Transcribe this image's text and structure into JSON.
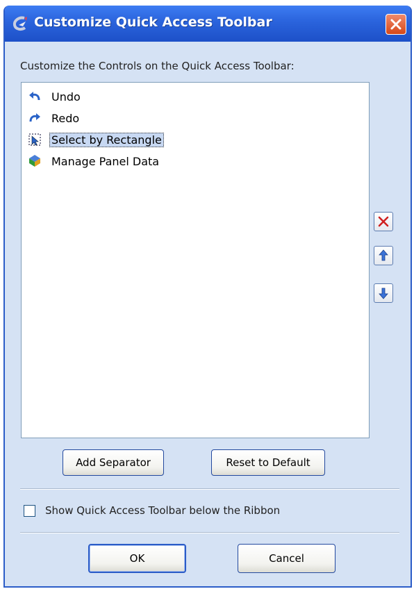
{
  "window": {
    "title": "Customize Quick Access Toolbar",
    "accent": "#2a63dc",
    "close_icon": "close-icon"
  },
  "list": {
    "label": "Customize the Controls on the Quick Access Toolbar:",
    "items": [
      {
        "label": "Undo",
        "icon": "undo-icon",
        "selected": false
      },
      {
        "label": "Redo",
        "icon": "redo-icon",
        "selected": false
      },
      {
        "label": "Select by Rectangle",
        "icon": "select-rectangle-icon",
        "selected": true
      },
      {
        "label": "Manage Panel Data",
        "icon": "manage-panel-data-icon",
        "selected": false
      }
    ]
  },
  "side_buttons": {
    "remove_icon": "remove-icon",
    "move_up_icon": "arrow-up-icon",
    "move_down_icon": "arrow-down-icon"
  },
  "buttons": {
    "add_separator": "Add Separator",
    "reset_default": "Reset to Default",
    "ok": "OK",
    "cancel": "Cancel"
  },
  "option": {
    "label": "Show Quick Access Toolbar below the Ribbon",
    "checked": false
  }
}
